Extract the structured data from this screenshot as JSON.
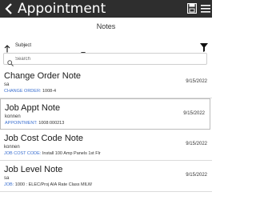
{
  "app": {
    "title": "Appointment",
    "icons": {
      "back": "chevron-left-icon",
      "save": "save-icon",
      "menu": "hamburger-menu-icon"
    },
    "colors": {
      "titlebar": "#2e2e2e",
      "link": "#3a6fd0"
    }
  },
  "page": {
    "heading": "Notes"
  },
  "sort": {
    "label": "Subject",
    "direction_icon": "arrow-up-icon"
  },
  "search": {
    "placeholder": "Search",
    "value": ""
  },
  "notes": [
    {
      "title": "Change Order Note",
      "user": "sa",
      "ref_key": "CHANGE ORDER:",
      "ref_value": "1008-4",
      "date": "9/15/2022"
    },
    {
      "title": "Job Appt Note",
      "user": "konnen",
      "ref_key": "APPOINTMENT:",
      "ref_value": "1008:000213",
      "date": "9/15/2022"
    },
    {
      "title": "Job Cost Code Note",
      "user": "konnen",
      "ref_key": "JOB COST CODE:",
      "ref_value": "Install 100 Amp Panels 1st Flr",
      "date": "9/15/2022"
    },
    {
      "title": "Job Level Note",
      "user": "sa",
      "ref_key": "JOB:",
      "ref_value": "1000 : ELEC/Proj AIA Rate Class MILW",
      "date": "9/15/2022"
    }
  ]
}
